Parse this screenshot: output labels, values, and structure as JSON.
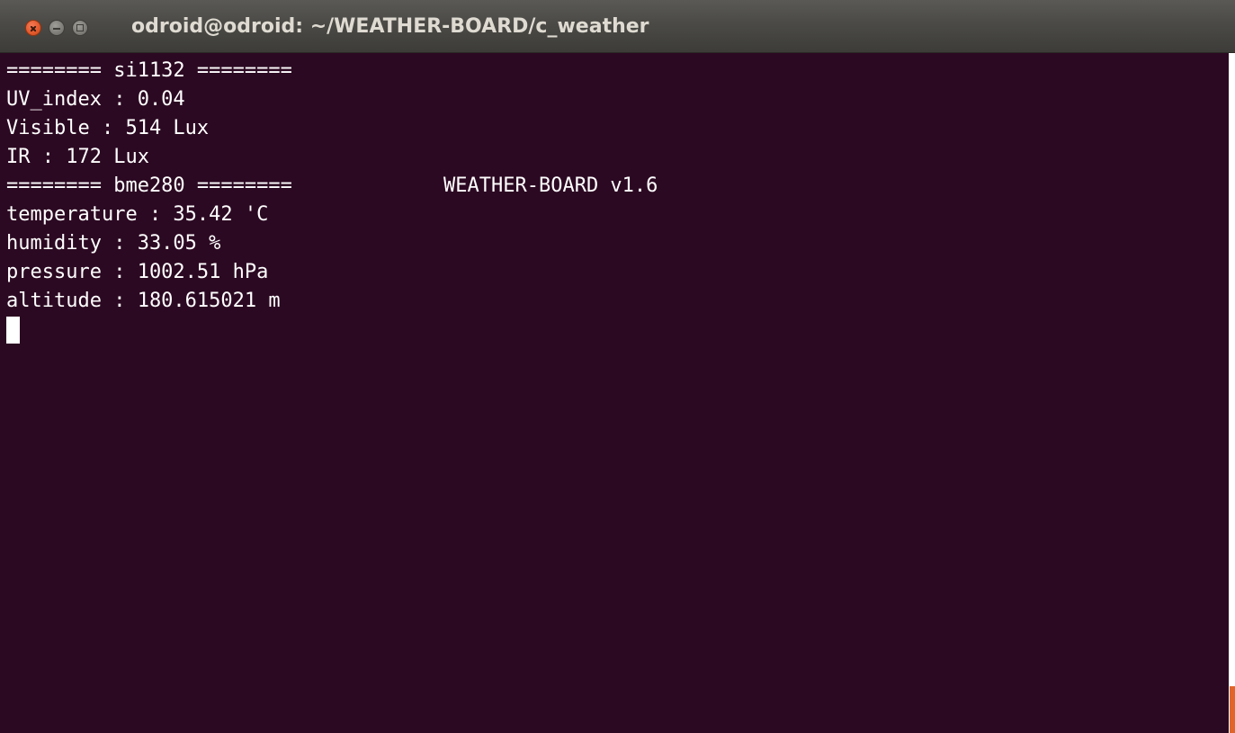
{
  "window": {
    "title": "odroid@odroid: ~/WEATHER-BOARD/c_weather"
  },
  "terminal": {
    "lines": [
      "======== si1132 ========",
      "UV_index : 0.04",
      "Visible : 514 Lux",
      "IR : 172 Lux",
      "======== bme280 ========",
      "temperature : 35.42 'C",
      "humidity : 33.05 %",
      "pressure : 1002.51 hPa",
      "altitude : 180.615021 m"
    ],
    "banner": "WEATHER-BOARD v1.6"
  },
  "colors": {
    "terminal_bg": "#2c0922",
    "text": "#ffffff",
    "close_button": "#e55b2e",
    "titlebar": "#4b4a46"
  }
}
